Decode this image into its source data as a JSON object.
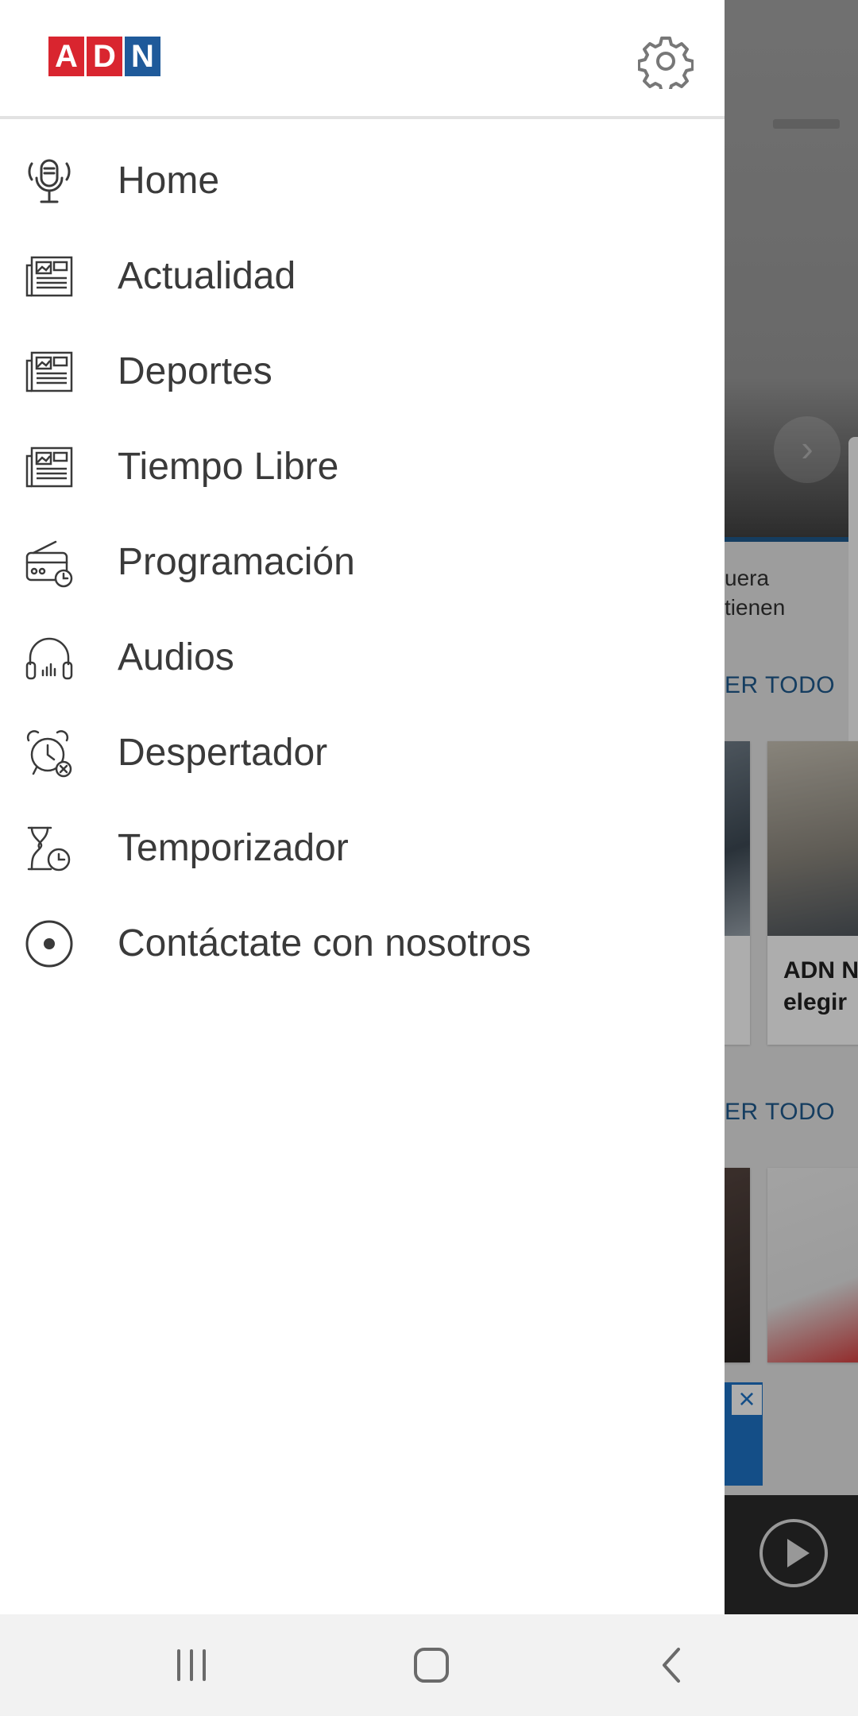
{
  "app": {
    "logo_letters": [
      "A",
      "D",
      "N"
    ],
    "settings_icon": "gear-icon"
  },
  "menu": [
    {
      "label": "Home",
      "icon": "microphone-icon"
    },
    {
      "label": "Actualidad",
      "icon": "newspaper-icon"
    },
    {
      "label": "Deportes",
      "icon": "newspaper-icon"
    },
    {
      "label": "Tiempo Libre",
      "icon": "newspaper-icon"
    },
    {
      "label": "Programación",
      "icon": "radio-clock-icon"
    },
    {
      "label": "Audios",
      "icon": "headphones-icon"
    },
    {
      "label": "Despertador",
      "icon": "alarm-clock-icon"
    },
    {
      "label": "Temporizador",
      "icon": "hourglass-clock-icon"
    },
    {
      "label": "Contáctate con nosotros",
      "icon": "radio-button-icon"
    }
  ],
  "background": {
    "snippet_line1": "uera",
    "snippet_line2": "tienen",
    "see_all_1": "ER TODO",
    "see_all_2": "ER TODO",
    "card_title_line1": "ADN N",
    "card_title_line2": "elegir"
  },
  "navbar": {
    "recents_icon": "recents-icon",
    "home_icon": "home-icon",
    "back_icon": "back-icon"
  },
  "colors": {
    "brand_red": "#d9252f",
    "brand_blue": "#1f5a9a",
    "link_blue": "#1f5a8e",
    "text": "#3a3a3a"
  }
}
